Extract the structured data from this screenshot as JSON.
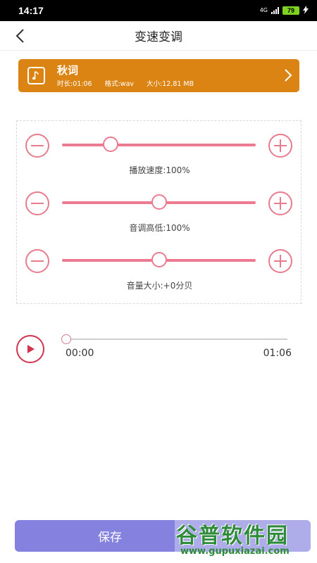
{
  "status_bar": {
    "time": "14:17",
    "network": "4G",
    "battery": "79"
  },
  "header": {
    "title": "变速变调"
  },
  "music": {
    "name": "秋词",
    "duration_label": "时长:01:06",
    "format_label": "格式:wav",
    "size_label": "大小:12.81 MB"
  },
  "controls": [
    {
      "label": "播放速度:100%",
      "level": 0.25
    },
    {
      "label": "音调高低:100%",
      "level": 0.5
    },
    {
      "label": "音量大小:+0分贝",
      "level": 0.5
    }
  ],
  "player": {
    "current": "00:00",
    "total": "01:06",
    "progress": 0.0
  },
  "save": {
    "label": "保存"
  },
  "watermark": {
    "text": "谷普软件园",
    "url": "www.gupuxiazai.com"
  },
  "colors": {
    "accent_orange": "#dc8413",
    "accent_pink": "#ec7b91",
    "save_purple": "#8581de"
  }
}
